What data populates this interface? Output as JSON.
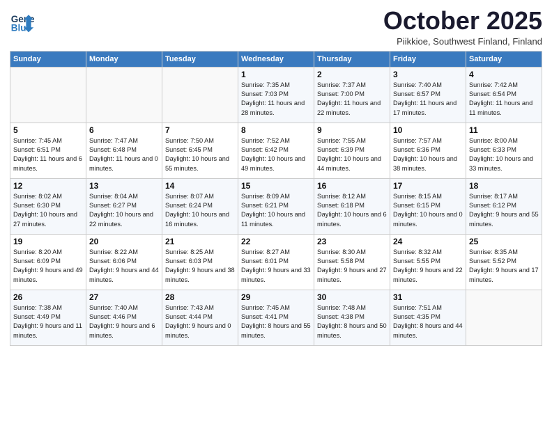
{
  "header": {
    "logo_line1": "General",
    "logo_line2": "Blue",
    "month": "October 2025",
    "location": "Piikkioe, Southwest Finland, Finland"
  },
  "weekdays": [
    "Sunday",
    "Monday",
    "Tuesday",
    "Wednesday",
    "Thursday",
    "Friday",
    "Saturday"
  ],
  "weeks": [
    [
      {
        "day": "",
        "info": ""
      },
      {
        "day": "",
        "info": ""
      },
      {
        "day": "",
        "info": ""
      },
      {
        "day": "1",
        "info": "Sunrise: 7:35 AM\nSunset: 7:03 PM\nDaylight: 11 hours\nand 28 minutes."
      },
      {
        "day": "2",
        "info": "Sunrise: 7:37 AM\nSunset: 7:00 PM\nDaylight: 11 hours\nand 22 minutes."
      },
      {
        "day": "3",
        "info": "Sunrise: 7:40 AM\nSunset: 6:57 PM\nDaylight: 11 hours\nand 17 minutes."
      },
      {
        "day": "4",
        "info": "Sunrise: 7:42 AM\nSunset: 6:54 PM\nDaylight: 11 hours\nand 11 minutes."
      }
    ],
    [
      {
        "day": "5",
        "info": "Sunrise: 7:45 AM\nSunset: 6:51 PM\nDaylight: 11 hours\nand 6 minutes."
      },
      {
        "day": "6",
        "info": "Sunrise: 7:47 AM\nSunset: 6:48 PM\nDaylight: 11 hours\nand 0 minutes."
      },
      {
        "day": "7",
        "info": "Sunrise: 7:50 AM\nSunset: 6:45 PM\nDaylight: 10 hours\nand 55 minutes."
      },
      {
        "day": "8",
        "info": "Sunrise: 7:52 AM\nSunset: 6:42 PM\nDaylight: 10 hours\nand 49 minutes."
      },
      {
        "day": "9",
        "info": "Sunrise: 7:55 AM\nSunset: 6:39 PM\nDaylight: 10 hours\nand 44 minutes."
      },
      {
        "day": "10",
        "info": "Sunrise: 7:57 AM\nSunset: 6:36 PM\nDaylight: 10 hours\nand 38 minutes."
      },
      {
        "day": "11",
        "info": "Sunrise: 8:00 AM\nSunset: 6:33 PM\nDaylight: 10 hours\nand 33 minutes."
      }
    ],
    [
      {
        "day": "12",
        "info": "Sunrise: 8:02 AM\nSunset: 6:30 PM\nDaylight: 10 hours\nand 27 minutes."
      },
      {
        "day": "13",
        "info": "Sunrise: 8:04 AM\nSunset: 6:27 PM\nDaylight: 10 hours\nand 22 minutes."
      },
      {
        "day": "14",
        "info": "Sunrise: 8:07 AM\nSunset: 6:24 PM\nDaylight: 10 hours\nand 16 minutes."
      },
      {
        "day": "15",
        "info": "Sunrise: 8:09 AM\nSunset: 6:21 PM\nDaylight: 10 hours\nand 11 minutes."
      },
      {
        "day": "16",
        "info": "Sunrise: 8:12 AM\nSunset: 6:18 PM\nDaylight: 10 hours\nand 6 minutes."
      },
      {
        "day": "17",
        "info": "Sunrise: 8:15 AM\nSunset: 6:15 PM\nDaylight: 10 hours\nand 0 minutes."
      },
      {
        "day": "18",
        "info": "Sunrise: 8:17 AM\nSunset: 6:12 PM\nDaylight: 9 hours\nand 55 minutes."
      }
    ],
    [
      {
        "day": "19",
        "info": "Sunrise: 8:20 AM\nSunset: 6:09 PM\nDaylight: 9 hours\nand 49 minutes."
      },
      {
        "day": "20",
        "info": "Sunrise: 8:22 AM\nSunset: 6:06 PM\nDaylight: 9 hours\nand 44 minutes."
      },
      {
        "day": "21",
        "info": "Sunrise: 8:25 AM\nSunset: 6:03 PM\nDaylight: 9 hours\nand 38 minutes."
      },
      {
        "day": "22",
        "info": "Sunrise: 8:27 AM\nSunset: 6:01 PM\nDaylight: 9 hours\nand 33 minutes."
      },
      {
        "day": "23",
        "info": "Sunrise: 8:30 AM\nSunset: 5:58 PM\nDaylight: 9 hours\nand 27 minutes."
      },
      {
        "day": "24",
        "info": "Sunrise: 8:32 AM\nSunset: 5:55 PM\nDaylight: 9 hours\nand 22 minutes."
      },
      {
        "day": "25",
        "info": "Sunrise: 8:35 AM\nSunset: 5:52 PM\nDaylight: 9 hours\nand 17 minutes."
      }
    ],
    [
      {
        "day": "26",
        "info": "Sunrise: 7:38 AM\nSunset: 4:49 PM\nDaylight: 9 hours\nand 11 minutes."
      },
      {
        "day": "27",
        "info": "Sunrise: 7:40 AM\nSunset: 4:46 PM\nDaylight: 9 hours\nand 6 minutes."
      },
      {
        "day": "28",
        "info": "Sunrise: 7:43 AM\nSunset: 4:44 PM\nDaylight: 9 hours\nand 0 minutes."
      },
      {
        "day": "29",
        "info": "Sunrise: 7:45 AM\nSunset: 4:41 PM\nDaylight: 8 hours\nand 55 minutes."
      },
      {
        "day": "30",
        "info": "Sunrise: 7:48 AM\nSunset: 4:38 PM\nDaylight: 8 hours\nand 50 minutes."
      },
      {
        "day": "31",
        "info": "Sunrise: 7:51 AM\nSunset: 4:35 PM\nDaylight: 8 hours\nand 44 minutes."
      },
      {
        "day": "",
        "info": ""
      }
    ]
  ]
}
